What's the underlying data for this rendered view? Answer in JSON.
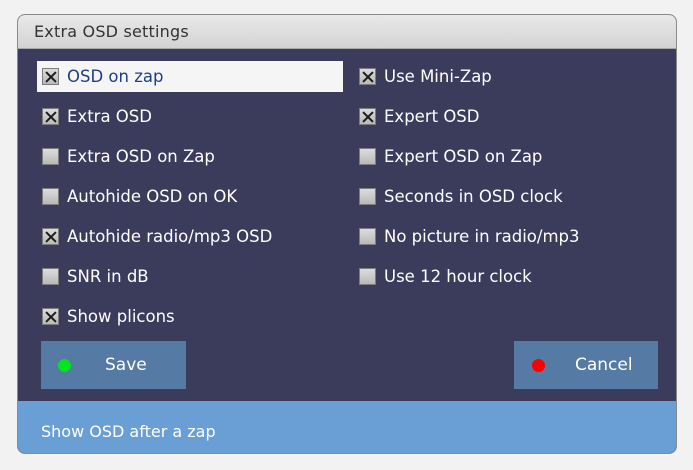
{
  "window": {
    "title": "Extra OSD settings"
  },
  "options": {
    "left": [
      {
        "label": "OSD on zap",
        "checked": true,
        "focused": true
      },
      {
        "label": "Extra OSD",
        "checked": true
      },
      {
        "label": "Extra OSD on Zap",
        "checked": false
      },
      {
        "label": "Autohide OSD on OK",
        "checked": false
      },
      {
        "label": "Autohide radio/mp3 OSD",
        "checked": true
      },
      {
        "label": "SNR in dB",
        "checked": false
      },
      {
        "label": "Show plicons",
        "checked": true
      }
    ],
    "right": [
      {
        "label": "Use Mini-Zap",
        "checked": true
      },
      {
        "label": "Expert OSD",
        "checked": true
      },
      {
        "label": "Expert OSD on Zap",
        "checked": false
      },
      {
        "label": "Seconds in OSD clock",
        "checked": false
      },
      {
        "label": "No picture in radio/mp3",
        "checked": false
      },
      {
        "label": "Use 12 hour clock",
        "checked": false
      }
    ]
  },
  "buttons": {
    "save": {
      "label": "Save",
      "dot_color": "#00e61e"
    },
    "cancel": {
      "label": "Cancel",
      "dot_color": "#ff0000"
    }
  },
  "status": {
    "text": "Show OSD after a zap"
  },
  "colors": {
    "panel": "#3b3b5c",
    "button": "#557aa3",
    "statusbar": "#6a9fd6"
  }
}
